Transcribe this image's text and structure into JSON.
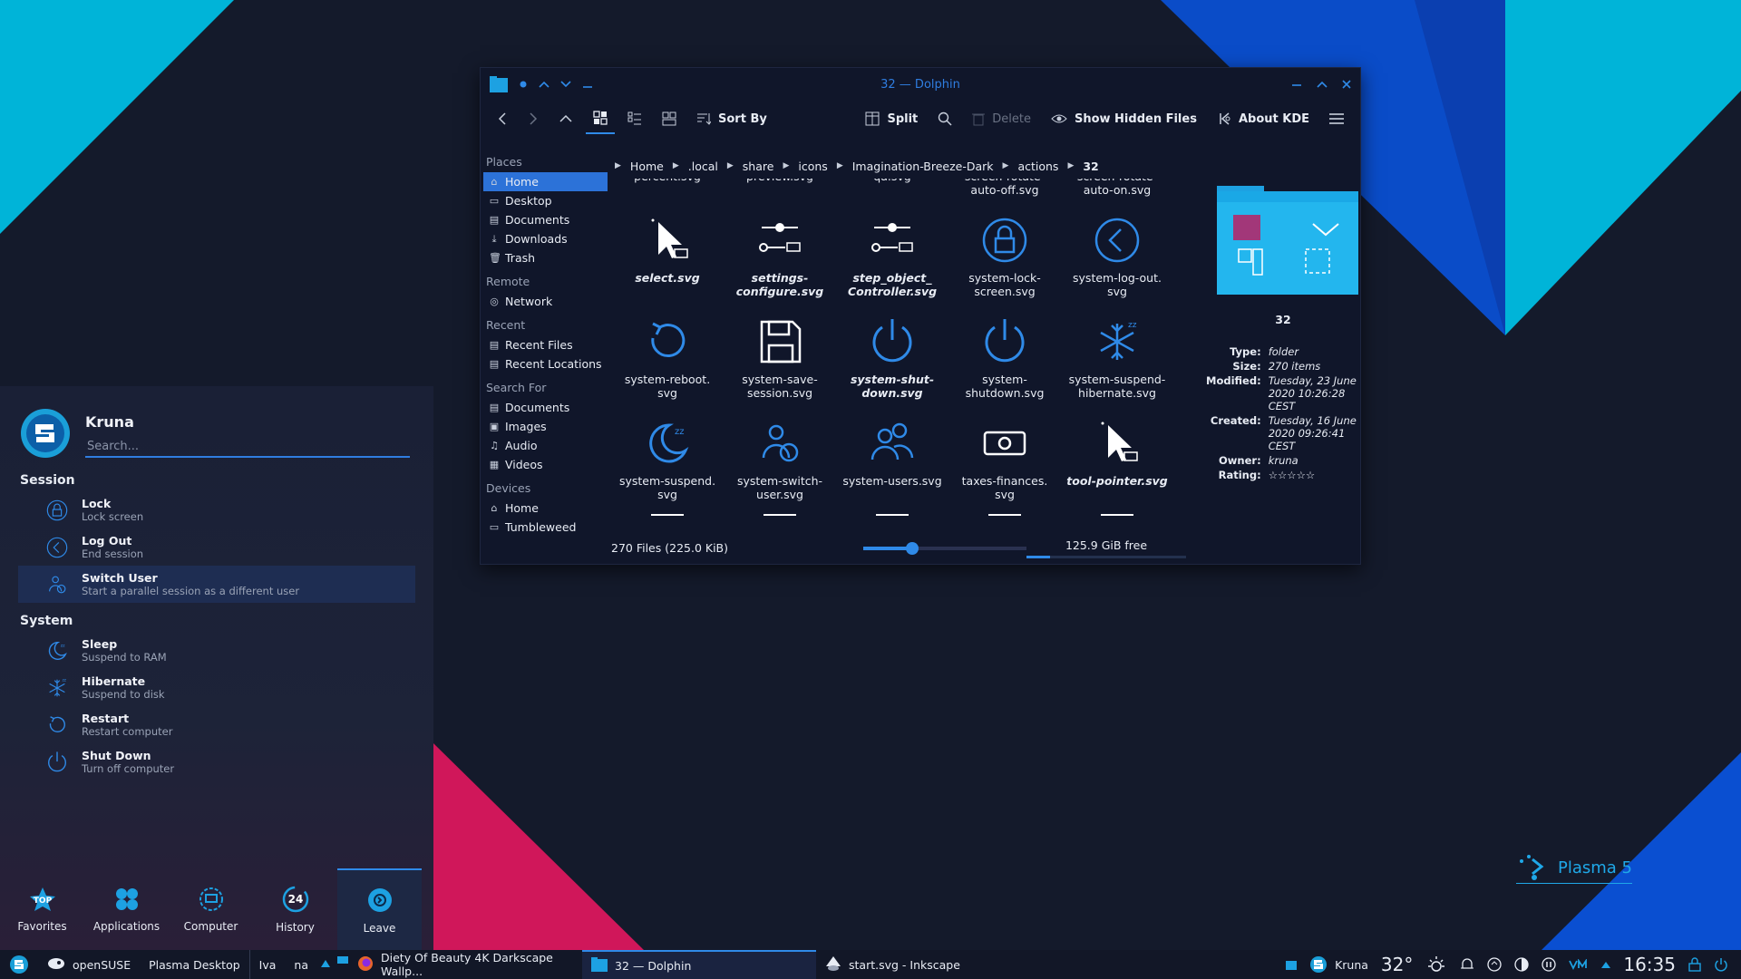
{
  "wallpaper": {
    "colors": {
      "bg": "#141a2b",
      "cyan": "#00b4d8",
      "blue": "#0a4fd1",
      "magenta": "#d0175a"
    }
  },
  "dolphin": {
    "title": "32 — Dolphin",
    "toolbar": {
      "sort_by": "Sort By",
      "split": "Split",
      "delete": "Delete",
      "show_hidden": "Show Hidden Files",
      "about_kde": "About KDE"
    },
    "places": {
      "sections": [
        {
          "header": "Places",
          "items": [
            "Home",
            "Desktop",
            "Documents",
            "Downloads",
            "Trash"
          ]
        },
        {
          "header": "Remote",
          "items": [
            "Network"
          ]
        },
        {
          "header": "Recent",
          "items": [
            "Recent Files",
            "Recent Locations"
          ]
        },
        {
          "header": "Search For",
          "items": [
            "Documents",
            "Images",
            "Audio",
            "Videos"
          ]
        },
        {
          "header": "Devices",
          "items": [
            "Home",
            "Tumbleweed"
          ]
        }
      ]
    },
    "breadcrumb": [
      "Home",
      ".local",
      "share",
      "icons",
      "Imagination-Breeze-Dark",
      "actions",
      "32"
    ],
    "partial_top_labels": [
      "percent.svg",
      "preview.svg",
      "qa.svg",
      "screen-rotate-\nauto-off.svg",
      "screen-rotate-\nauto-on.svg"
    ],
    "files": [
      {
        "name": "select.svg",
        "icon": "pointer-icon",
        "italic": true
      },
      {
        "name": "settings-\nconfigure.svg",
        "icon": "slider-icon",
        "italic": true
      },
      {
        "name": "step_object_\nController.svg",
        "icon": "slider-icon",
        "italic": true
      },
      {
        "name": "system-lock-\nscreen.svg",
        "icon": "lock-icon",
        "italic": false
      },
      {
        "name": "system-log-out.\nsvg",
        "icon": "logout-icon",
        "italic": false
      },
      {
        "name": "system-reboot.\nsvg",
        "icon": "reboot-icon",
        "italic": false
      },
      {
        "name": "system-save-\nsession.svg",
        "icon": "floppy-icon",
        "italic": false
      },
      {
        "name": "system-shut-\ndown.svg",
        "icon": "power-icon",
        "italic": true
      },
      {
        "name": "system-\nshutdown.svg",
        "icon": "power-icon",
        "italic": false
      },
      {
        "name": "system-suspend-\nhibernate.svg",
        "icon": "snowflake-icon",
        "italic": false
      },
      {
        "name": "system-suspend.\nsvg",
        "icon": "moon-icon",
        "italic": false
      },
      {
        "name": "system-switch-\nuser.svg",
        "icon": "switch-user-icon",
        "italic": false
      },
      {
        "name": "system-users.svg",
        "icon": "users-icon",
        "italic": false
      },
      {
        "name": "taxes-finances.\nsvg",
        "icon": "money-icon",
        "italic": false
      },
      {
        "name": "tool-pointer.svg",
        "icon": "pointer-icon",
        "italic": true
      }
    ],
    "status": {
      "count": "270 Files (225.0 KiB)",
      "free": "125.9 GiB free",
      "zoom_fraction": 0.3,
      "free_fraction": 0.15
    },
    "info": {
      "name": "32",
      "rows": [
        {
          "k": "Type:",
          "v": "folder"
        },
        {
          "k": "Size:",
          "v": "270 items"
        },
        {
          "k": "Modified:",
          "v": "Tuesday, 23 June 2020 10:26:28 CEST"
        },
        {
          "k": "Created:",
          "v": "Tuesday, 16 June 2020 09:26:41 CEST"
        },
        {
          "k": "Owner:",
          "v": "kruna"
        },
        {
          "k": "Rating:",
          "v": "☆☆☆☆☆"
        }
      ]
    }
  },
  "launcher": {
    "user": "Kruna",
    "search_placeholder": "Search...",
    "session_header": "Session",
    "session": [
      {
        "title": "Lock",
        "sub": "Lock screen",
        "icon": "lock-icon"
      },
      {
        "title": "Log Out",
        "sub": "End session",
        "icon": "logout-icon"
      },
      {
        "title": "Switch User",
        "sub": "Start a parallel session as a different user",
        "icon": "switch-user-icon",
        "selected": true
      }
    ],
    "system_header": "System",
    "system": [
      {
        "title": "Sleep",
        "sub": "Suspend to RAM",
        "icon": "moon-icon"
      },
      {
        "title": "Hibernate",
        "sub": "Suspend to disk",
        "icon": "snowflake-icon"
      },
      {
        "title": "Restart",
        "sub": "Restart computer",
        "icon": "reboot-icon"
      },
      {
        "title": "Shut Down",
        "sub": "Turn off computer",
        "icon": "power-icon"
      }
    ],
    "tabs": [
      {
        "label": "Favorites",
        "icon": "top-icon"
      },
      {
        "label": "Applications",
        "icon": "apps-icon"
      },
      {
        "label": "Computer",
        "icon": "computer-icon"
      },
      {
        "label": "History",
        "icon": "history-icon",
        "badge": "24"
      },
      {
        "label": "Leave",
        "icon": "leave-icon",
        "active": true
      }
    ]
  },
  "taskbar": {
    "items": [
      {
        "label": "openSUSE",
        "icon": "opensuse-icon"
      },
      {
        "label": "Plasma Desktop",
        "icon": ""
      },
      {
        "label": "Iva",
        "icon": ""
      },
      {
        "label": "na",
        "icon": ""
      },
      {
        "label": "Diety Of Beauty 4K Darkscape Wallp...",
        "icon": "firefox-icon"
      },
      {
        "label": "32 — Dolphin",
        "icon": "folder-icon",
        "active": true
      },
      {
        "label": "start.svg - Inkscape",
        "icon": "inkscape-icon"
      }
    ],
    "user": "Kruna",
    "temp": "32°",
    "clock": "16:35"
  },
  "plasma_label": "Plasma 5"
}
